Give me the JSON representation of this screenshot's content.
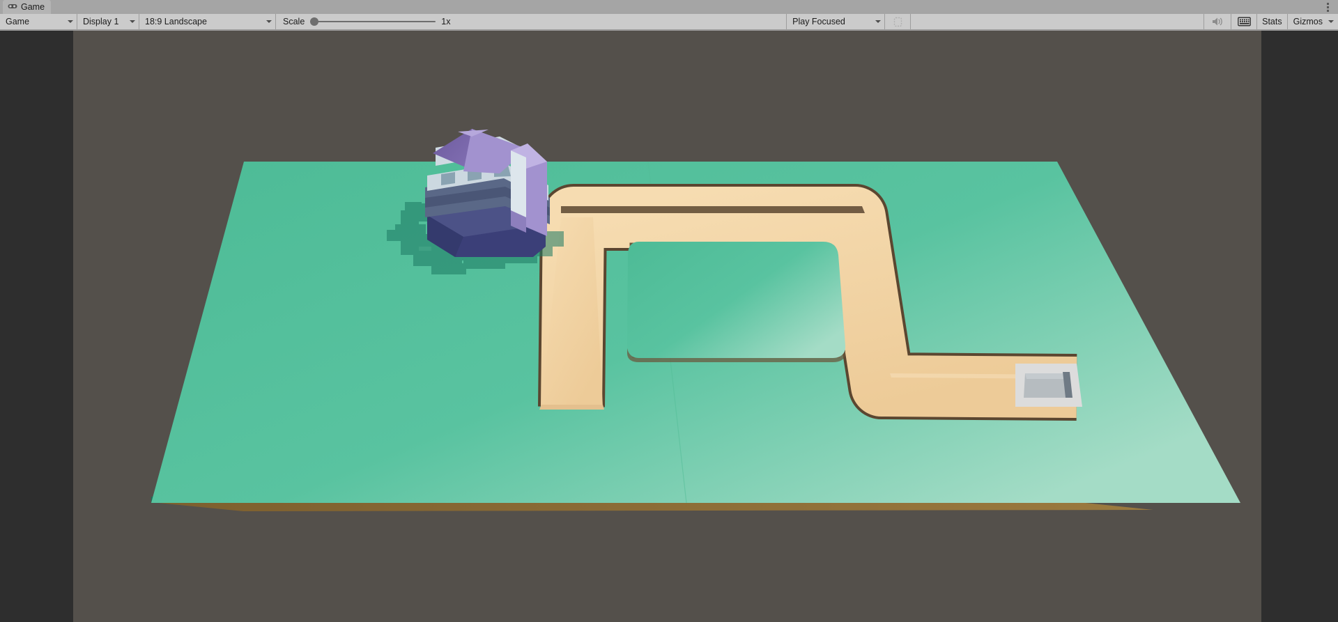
{
  "window": {
    "tab_label": "Game",
    "tab_icon": "gamepad-icon",
    "menu_icon": "kebab-menu-icon"
  },
  "toolbar": {
    "view_mode": "Game",
    "display": "Display 1",
    "aspect_ratio": "18:9 Landscape",
    "scale_label": "Scale",
    "scale_value": "1x",
    "scale_slider_position": 0,
    "play_mode": "Play Focused",
    "mute_icon": "speaker-mute-icon",
    "stats_toggle_icon": "frame-debug-icon",
    "stats_label": "Stats",
    "gizmos_label": "Gizmos",
    "gizmos_caret_icon": "chevron-down-icon"
  },
  "scene": {
    "name": "tower-defense-level",
    "background_color": "#54504b",
    "letterbox_color": "#2e2e2e",
    "terrain": {
      "name": "grass-platform",
      "top_color": "#5bc4a0",
      "top_color_light": "#8fd6bd",
      "edge_color": "#1f6d58",
      "under_color": "#8a6a36"
    },
    "path": {
      "name": "enemy-path",
      "fill_color": "#f3d4a4",
      "fill_color_dark": "#e8c392",
      "outline_color": "#5b4630"
    },
    "castle": {
      "name": "player-castle",
      "roof_color": "#6d5b9e",
      "roof_color_light": "#a292cf",
      "wall_color": "#ccd8e0",
      "wall_shadow_color": "#7f98a8",
      "base_color": "#3b3f78",
      "base_mid_color": "#5a6887"
    },
    "end_tile": {
      "name": "spawn-tile",
      "frame_color": "#dcdcdc",
      "pad_color": "#b6bcc0",
      "block_color": "#6f7a85"
    },
    "shadow_color": "#2f8a72"
  }
}
